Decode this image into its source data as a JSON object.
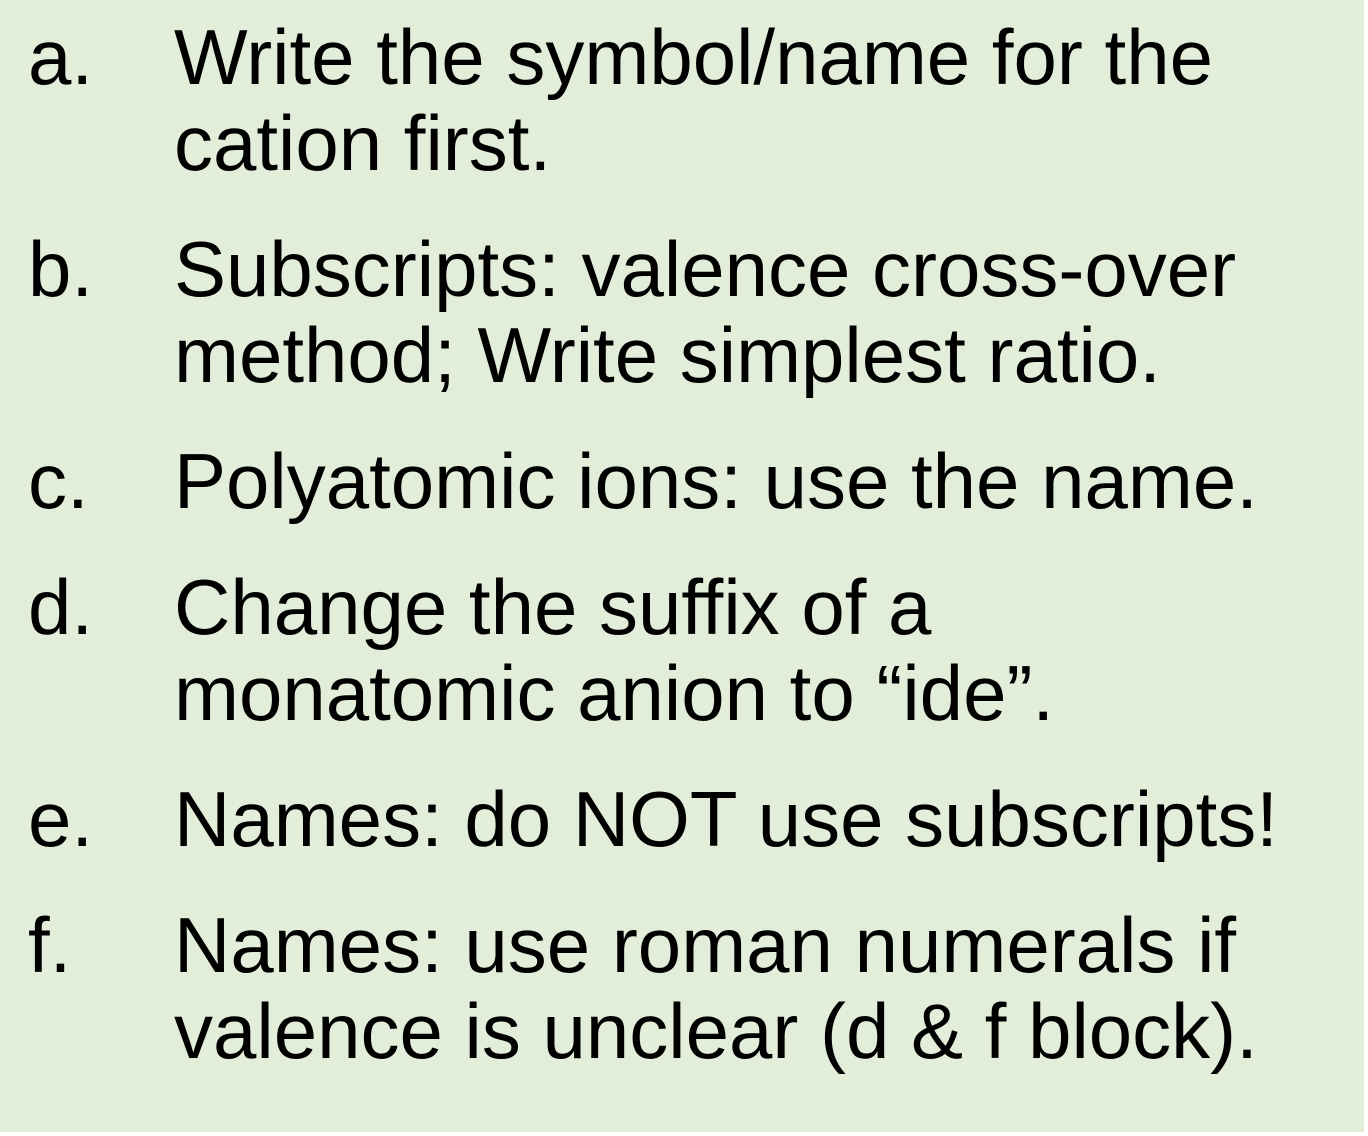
{
  "list": {
    "items": [
      {
        "marker": "a.",
        "lines": [
          "Write the symbol/name  for the",
          "cation first."
        ]
      },
      {
        "marker": "b.",
        "lines": [
          "Subscripts: valence cross-over",
          "method; Write simplest ratio."
        ]
      },
      {
        "marker": "c.",
        "lines": [
          "Polyatomic ions: use the name."
        ]
      },
      {
        "marker": "d.",
        "lines": [
          "Change the suffix of a",
          "monatomic anion to “ide”."
        ]
      },
      {
        "marker": "e.",
        "lines": [
          "Names: do NOT use subscripts!"
        ]
      },
      {
        "marker": "f.",
        "lines": [
          "Names: use roman numerals if",
          "valence is unclear (d & f block)."
        ]
      }
    ]
  },
  "colors": {
    "background": "#e2eed9",
    "text": "#000000"
  }
}
